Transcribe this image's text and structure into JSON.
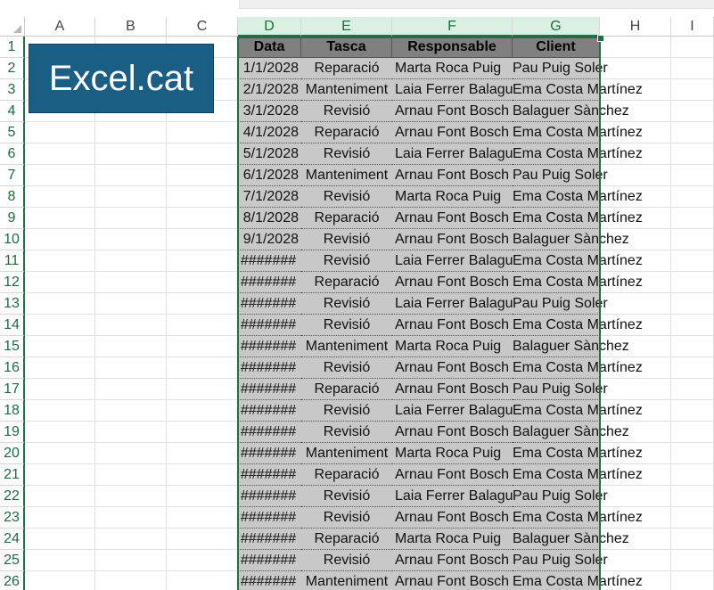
{
  "columns": [
    "A",
    "B",
    "C",
    "D",
    "E",
    "F",
    "G",
    "H",
    "I"
  ],
  "rows": [
    "1",
    "2",
    "3",
    "4",
    "5",
    "6",
    "7",
    "8",
    "9",
    "10",
    "11",
    "12",
    "13",
    "14",
    "15",
    "16",
    "17",
    "18",
    "19",
    "20",
    "21",
    "22",
    "23",
    "24",
    "25",
    "26"
  ],
  "logo": {
    "text": "Excel.cat",
    "color": "#1b5e84"
  },
  "table": {
    "headers": [
      "Data",
      "Tasca",
      "Responsable",
      "Client"
    ],
    "rows": [
      [
        "1/1/2028",
        "Reparació",
        "Marta Roca Puig",
        "Pau Puig Soler"
      ],
      [
        "2/1/2028",
        "Manteniment",
        "Laia Ferrer Balaguer",
        "Ema Costa Martínez"
      ],
      [
        "3/1/2028",
        "Revisió",
        "Arnau Font Bosch",
        "Balaguer Sànchez"
      ],
      [
        "4/1/2028",
        "Reparació",
        "Arnau Font Bosch",
        "Ema Costa Martínez"
      ],
      [
        "5/1/2028",
        "Revisió",
        "Laia Ferrer Balaguer",
        "Ema Costa Martínez"
      ],
      [
        "6/1/2028",
        "Manteniment",
        "Arnau Font Bosch",
        "Pau Puig Soler"
      ],
      [
        "7/1/2028",
        "Revisió",
        "Marta Roca Puig",
        "Ema Costa Martínez"
      ],
      [
        "8/1/2028",
        "Reparació",
        "Arnau Font Bosch",
        "Ema Costa Martínez"
      ],
      [
        "9/1/2028",
        "Revisió",
        "Arnau Font Bosch",
        "Balaguer Sànchez"
      ],
      [
        "#######",
        "Revisió",
        "Laia Ferrer Balaguer",
        "Ema Costa Martínez"
      ],
      [
        "#######",
        "Reparació",
        "Arnau Font Bosch",
        "Ema Costa Martínez"
      ],
      [
        "#######",
        "Revisió",
        "Laia Ferrer Balaguer",
        "Pau Puig Soler"
      ],
      [
        "#######",
        "Revisió",
        "Arnau Font Bosch",
        "Ema Costa Martínez"
      ],
      [
        "#######",
        "Manteniment",
        "Marta Roca Puig",
        "Balaguer Sànchez"
      ],
      [
        "#######",
        "Revisió",
        "Arnau Font Bosch",
        "Ema Costa Martínez"
      ],
      [
        "#######",
        "Reparació",
        "Arnau Font Bosch",
        "Pau Puig Soler"
      ],
      [
        "#######",
        "Revisió",
        "Laia Ferrer Balaguer",
        "Ema Costa Martínez"
      ],
      [
        "#######",
        "Revisió",
        "Arnau Font Bosch",
        "Balaguer Sànchez"
      ],
      [
        "#######",
        "Manteniment",
        "Marta Roca Puig",
        "Ema Costa Martínez"
      ],
      [
        "#######",
        "Reparació",
        "Arnau Font Bosch",
        "Ema Costa Martínez"
      ],
      [
        "#######",
        "Revisió",
        "Laia Ferrer Balaguer",
        "Pau Puig Soler"
      ],
      [
        "#######",
        "Revisió",
        "Arnau Font Bosch",
        "Ema Costa Martínez"
      ],
      [
        "#######",
        "Reparació",
        "Marta Roca Puig",
        "Balaguer Sànchez"
      ],
      [
        "#######",
        "Revisió",
        "Arnau Font Bosch",
        "Pau Puig Soler"
      ],
      [
        "#######",
        "Manteniment",
        "Arnau Font Bosch",
        "Ema Costa Martínez"
      ]
    ]
  },
  "colors": {
    "selection": "#1e7145",
    "header_fill": "#808080",
    "cell_fill": "#c8c8c8"
  }
}
